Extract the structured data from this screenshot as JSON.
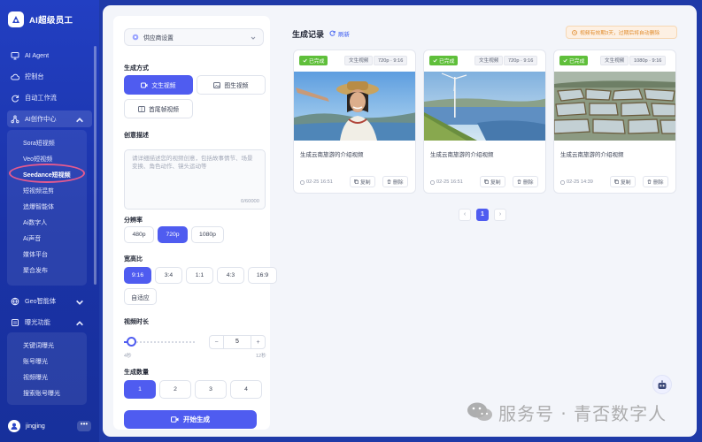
{
  "brand": {
    "name": "AI超级员工"
  },
  "sidebar": {
    "items": [
      {
        "label": "AI Agent",
        "icon": "monitor-icon"
      },
      {
        "label": "控制台",
        "icon": "cloud-icon"
      },
      {
        "label": "自动工作流",
        "icon": "refresh-icon"
      },
      {
        "label": "AI创作中心",
        "icon": "network-icon",
        "expanded": true
      },
      {
        "label": "Geo智能体",
        "icon": "globe-icon"
      },
      {
        "label": "曝光功能",
        "icon": "list-icon",
        "expanded": true
      }
    ],
    "creation_sub": [
      "Sora短视频",
      "Veo短视频",
      "Seedance短视频",
      "短视频混剪",
      "追爆智能体",
      "Ai数字人",
      "Ai声音",
      "媒体平台",
      "聚合发布"
    ],
    "creation_active": "Seedance短视频",
    "exposure_sub": [
      "关键词曝光",
      "账号曝光",
      "视频曝光",
      "搜索账号曝光"
    ],
    "user": {
      "name": "jingjing",
      "more": "•••"
    }
  },
  "settings": {
    "provider": "供应商设置",
    "mode_label": "生成方式",
    "modes": [
      "文生视频",
      "图生视频",
      "首尾帧视频"
    ],
    "mode_selected": "文生视频",
    "desc_label": "创意描述",
    "desc_placeholder": "请详细描述您的视频创意，包括故事情节、场景变换、角色动作、镜头运动等",
    "desc_count": "0/60000",
    "resolution_label": "分辨率",
    "resolutions": [
      "480p",
      "720p",
      "1080p"
    ],
    "resolution_selected": "720p",
    "ratio_label": "宽高比",
    "ratios": [
      "9:16",
      "3:4",
      "1:1",
      "4:3",
      "16:9",
      "自适应"
    ],
    "ratio_selected": "9:16",
    "duration_label": "视频时长",
    "duration_min": "4秒",
    "duration_max": "12秒",
    "duration_value": "5",
    "stepper_minus": "−",
    "stepper_plus": "+",
    "count_label": "生成数量",
    "counts": [
      "1",
      "2",
      "3",
      "4"
    ],
    "count_selected": "1",
    "generate": "开始生成"
  },
  "records": {
    "title": "生成记录",
    "refresh": "刷新",
    "notice": "视频有效期3天，过期后将自动删除",
    "cards": [
      {
        "status": "已完成",
        "type": "文生视频",
        "meta": "720p · 9:16",
        "title": "生成云南旅游的介绍视频",
        "time": "02-25 16:51",
        "copy": "复制",
        "delete": "删除",
        "scene": "portrait"
      },
      {
        "status": "已完成",
        "type": "文生视频",
        "meta": "720p · 9:16",
        "title": "生成云南旅游的介绍视频",
        "time": "02-25 16:51",
        "copy": "复制",
        "delete": "删除",
        "scene": "lake"
      },
      {
        "status": "已完成",
        "type": "文生视频",
        "meta": "1080p · 9:16",
        "title": "生成云南旅游的介绍视频",
        "time": "02-25 14:39",
        "copy": "复制",
        "delete": "删除",
        "scene": "terraces"
      }
    ],
    "pagination": {
      "prev": "‹",
      "current": "1",
      "next": "›"
    }
  },
  "watermark": {
    "text": "服务号 · 青否数字人"
  },
  "colors": {
    "accent": "#4f5cf0",
    "sidebar": "#1f3aa8",
    "success": "#5fbf3a",
    "warning": "#e08a2a",
    "highlight": "#e45a8f"
  }
}
